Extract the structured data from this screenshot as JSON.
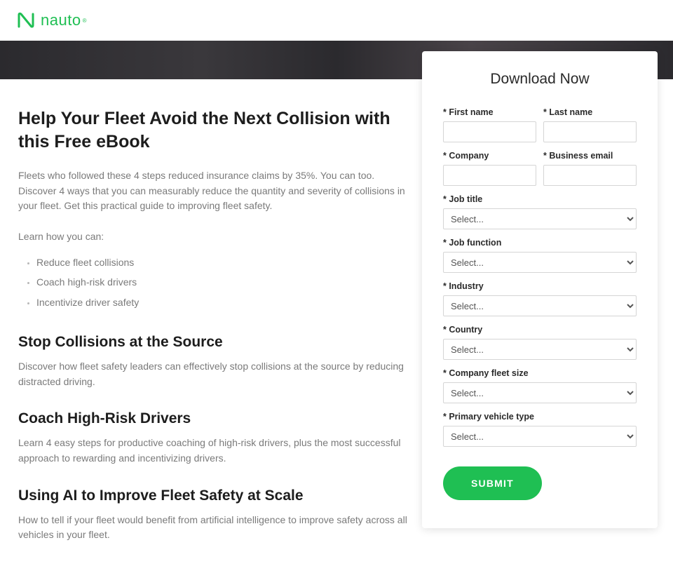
{
  "brand": {
    "name": "nauto"
  },
  "main": {
    "title": "Help Your Fleet Avoid the Next Collision with this Free eBook",
    "intro": "Fleets who followed these 4 steps reduced insurance claims by 35%. You can too. Discover 4 ways that you can measurably reduce the quantity and severity of collisions in your fleet. Get this practical guide to improving fleet safety.",
    "learn_prefix": "Learn how you can:",
    "bullets": [
      "Reduce fleet collisions",
      "Coach high-risk drivers",
      "Incentivize driver safety"
    ],
    "sections": [
      {
        "heading": "Stop Collisions at the Source",
        "body": "Discover how fleet safety leaders can effectively stop collisions at the source by reducing distracted driving."
      },
      {
        "heading": "Coach High-Risk Drivers",
        "body": "Learn 4 easy steps for productive coaching of high-risk drivers, plus the most successful approach to rewarding and incentivizing drivers."
      },
      {
        "heading": "Using AI to Improve Fleet Safety at Scale",
        "body": "How to tell if your fleet would benefit from artificial intelligence to improve safety across all vehicles in your fleet."
      }
    ]
  },
  "form": {
    "title": "Download Now",
    "labels": {
      "first_name": "* First name",
      "last_name": "* Last name",
      "company": "* Company",
      "email": "* Business email",
      "job_title": "* Job title",
      "job_function": "* Job function",
      "industry": "* Industry",
      "country": "* Country",
      "fleet_size": "* Company fleet size",
      "vehicle_type": "* Primary vehicle type"
    },
    "select_placeholder": "Select...",
    "submit": "SUBMIT"
  }
}
